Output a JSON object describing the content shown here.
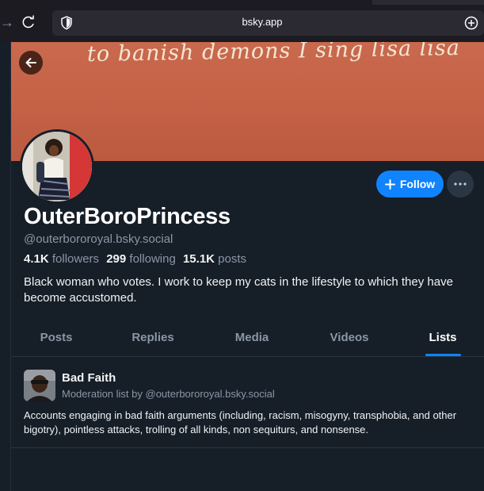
{
  "browser": {
    "url": "bsky.app",
    "icons": {
      "forward": "arrow-right-icon",
      "reload": "reload-icon",
      "security": "shield-icon",
      "extension": "extension-icon"
    }
  },
  "profile": {
    "banner_text": "to banish demons I sing lisa lisa",
    "display_name": "OuterBoroPrincess",
    "handle": "@outerbororoyal.bsky.social",
    "followers_count": "4.1K",
    "followers_label": "followers",
    "following_count": "299",
    "following_label": "following",
    "posts_count": "15.1K",
    "posts_label": "posts",
    "bio": "Black woman who votes. I work to keep my cats in the lifestyle to which they have become accustomed.",
    "follow_label": "Follow"
  },
  "tabs": [
    {
      "label": "Posts",
      "active": false
    },
    {
      "label": "Replies",
      "active": false
    },
    {
      "label": "Media",
      "active": false
    },
    {
      "label": "Videos",
      "active": false
    },
    {
      "label": "Lists",
      "active": true
    }
  ],
  "lists": [
    {
      "title": "Bad Faith",
      "meta": "Moderation list by @outerbororoyal.bsky.social",
      "description": "Accounts engaging in bad faith arguments (including, racism, misogyny, transphobia, and other bigotry), pointless attacks, trolling of all kinds, non sequiturs, and nonsense."
    }
  ],
  "colors": {
    "accent": "#1083fe",
    "background": "#161e27",
    "muted_text": "#8a97a7",
    "banner": "#c46146"
  }
}
